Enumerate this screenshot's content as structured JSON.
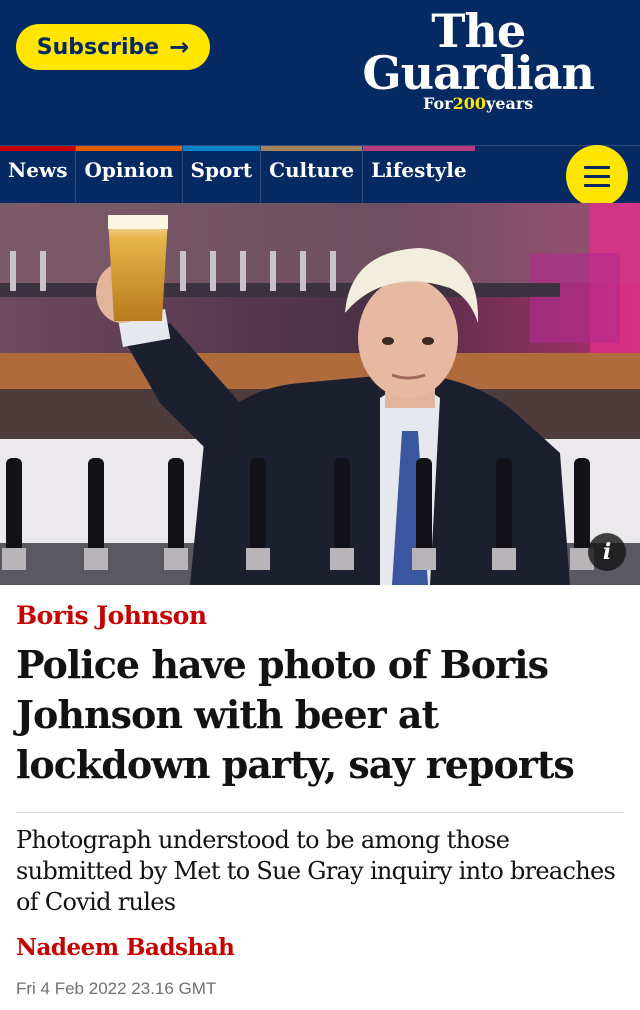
{
  "header": {
    "subscribe_label": "Subscribe",
    "logo_the": "The",
    "logo_name": "Guardian",
    "tagline_prefix": "For",
    "tagline_number": "200",
    "tagline_suffix": "years"
  },
  "nav": {
    "items": [
      {
        "label": "News",
        "color": "#c70000"
      },
      {
        "label": "Opinion",
        "color": "#e05e00"
      },
      {
        "label": "Sport",
        "color": "#0084c6"
      },
      {
        "label": "Culture",
        "color": "#a1845c"
      },
      {
        "label": "Lifestyle",
        "color": "#bb3b80"
      }
    ],
    "menu_icon": "hamburger-menu-icon"
  },
  "hero": {
    "info_label": "i"
  },
  "article": {
    "kicker": "Boris Johnson",
    "headline": "Police have photo of Boris Johnson with beer at lockdown party, say reports",
    "standfirst": "Photograph understood to be among those submitted by Met to Sue Gray inquiry into breaches of Covid rules",
    "byline": "Nadeem Badshah",
    "date": "Fri 4 Feb 2022 23.16 GMT"
  },
  "colors": {
    "brand_blue": "#052962",
    "brand_yellow": "#ffe500",
    "news_red": "#c70000"
  }
}
